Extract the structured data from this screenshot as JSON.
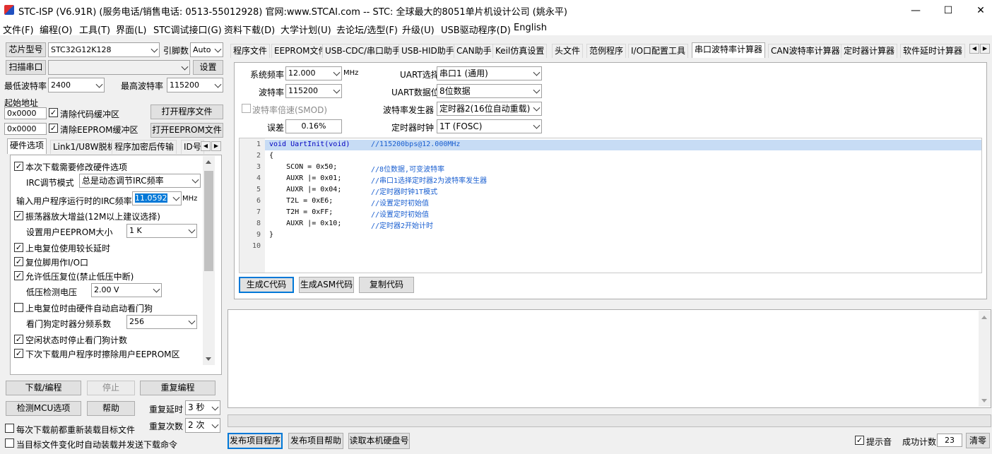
{
  "window": {
    "title": "STC-ISP (V6.91R) (服务电话/销售电话: 0513-55012928) 官网:www.STCAI.com  -- STC: 全球最大的8051单片机设计公司 (姚永平)",
    "minimize": "—",
    "maximize": "☐",
    "close": "✕"
  },
  "menu": [
    "文件(F)",
    "编程(O)",
    "工具(T)",
    "界面(L)",
    "STC调试接口(G)",
    "资料下载(D)",
    "大学计划(U)",
    "去论坛/选型(F)",
    "升级(U)",
    "USB驱动程序(D)",
    "English"
  ],
  "left": {
    "chip_btn": "芯片型号",
    "chip_value": "STC32G12K128",
    "pin_label": "引脚数",
    "pin_value": "Auto",
    "scan_btn": "扫描串口",
    "port_value": "",
    "settings_btn": "设置",
    "min_baud_label": "最低波特率",
    "min_baud": "2400",
    "max_baud_label": "最高波特率",
    "max_baud": "115200",
    "start_addr_label": "起始地址",
    "addr1": "0x0000",
    "clear_code": "清除代码缓冲区",
    "open_prog": "打开程序文件",
    "addr2": "0x0000",
    "clear_eeprom": "清除EEPROM缓冲区",
    "open_eeprom": "打开EEPROM文件",
    "tabs": [
      "硬件选项",
      "Link1/U8W脱机",
      "程序加密后传输",
      "ID号"
    ],
    "options": {
      "opt1": "本次下载需要修改硬件选项",
      "irc_mode_label": "IRC调节模式",
      "irc_mode": "总是动态调节IRC频率",
      "irc_freq_label": "输入用户程序运行时的IRC频率",
      "irc_freq": "11.0592",
      "irc_unit": "MHz",
      "opt2": "振荡器放大增益(12M以上建议选择)",
      "eeprom_label": "设置用户EEPROM大小",
      "eeprom_size": "1   K",
      "opt3": "上电复位使用较长延时",
      "opt4": "复位脚用作I/O口",
      "opt5": "允许低压复位(禁止低压中断)",
      "lvd_label": "低压检测电压",
      "lvd_value": "2.00 V",
      "opt6": "上电复位时由硬件自动启动看门狗",
      "wdt_label": "看门狗定时器分频系数",
      "wdt_value": "256",
      "opt7": "空闲状态时停止看门狗计数",
      "opt8": "下次下载用户程序时擦除用户EEPROM区"
    },
    "download_btn": "下载/编程",
    "stop_btn": "停止",
    "reprogram_btn": "重复编程",
    "detect_btn": "检测MCU选项",
    "help_btn": "帮助",
    "repeat_delay_label": "重复延时",
    "repeat_delay": "3 秒",
    "repeat_count_label": "重复次数",
    "repeat_count": "2 次",
    "reload_each": "每次下载前都重新装载目标文件",
    "auto_reload": "当目标文件变化时自动装载并发送下载命令"
  },
  "right": {
    "tabs": [
      "程序文件",
      "EEPROM文件",
      "USB-CDC/串口助手",
      "USB-HID助手",
      "CAN助手",
      "Keil仿真设置",
      "头文件",
      "范例程序",
      "I/O口配置工具",
      "串口波特率计算器",
      "CAN波特率计算器",
      "定时器计算器",
      "软件延时计算器"
    ],
    "sysfreq_label": "系统频率",
    "sysfreq": "12.000",
    "mhz": "MHz",
    "baud_label": "波特率",
    "baud": "115200",
    "double_label": "波特率倍速(SMOD)",
    "err_label": "误差",
    "err_value": "0.16%",
    "uart_sel_label": "UART选择",
    "uart_sel": "串口1 (通用)",
    "uart_bits_label": "UART数据位",
    "uart_bits": "8位数据",
    "gen_label": "波特率发生器",
    "gen_value": "定时器2(16位自动重载)",
    "clk_label": "定时器时钟",
    "clk_value": "1T  (FOSC)",
    "code_lines": [
      {
        "n": "1",
        "kw": "void UartInit(void)",
        "rest": "",
        "c": "//115200bps@12.000MHz"
      },
      {
        "n": "2",
        "kw": "",
        "rest": "{",
        "c": ""
      },
      {
        "n": "3",
        "kw": "",
        "rest": "    SCON = 0x50;",
        "c": "//8位数据,可变波特率"
      },
      {
        "n": "4",
        "kw": "",
        "rest": "    AUXR |= 0x01;",
        "c": "//串口1选择定时器2为波特率发生器"
      },
      {
        "n": "5",
        "kw": "",
        "rest": "    AUXR |= 0x04;",
        "c": "//定时器时钟1T模式"
      },
      {
        "n": "6",
        "kw": "",
        "rest": "    T2L = 0xE6;",
        "c": "//设置定时初始值"
      },
      {
        "n": "7",
        "kw": "",
        "rest": "    T2H = 0xFF;",
        "c": "//设置定时初始值"
      },
      {
        "n": "8",
        "kw": "",
        "rest": "    AUXR |= 0x10;",
        "c": "//定时器2开始计时"
      },
      {
        "n": "9",
        "kw": "",
        "rest": "}",
        "c": ""
      },
      {
        "n": "10",
        "kw": "",
        "rest": "",
        "c": ""
      }
    ],
    "gen_c_btn": "生成C代码",
    "gen_asm_btn": "生成ASM代码",
    "copy_btn": "复制代码",
    "publish_btn": "发布项目程序",
    "publish_help_btn": "发布项目帮助",
    "read_disk_btn": "读取本机硬盘号",
    "beep_label": "提示音",
    "success_label": "成功计数",
    "success_count": "23",
    "clear_btn": "清零"
  }
}
